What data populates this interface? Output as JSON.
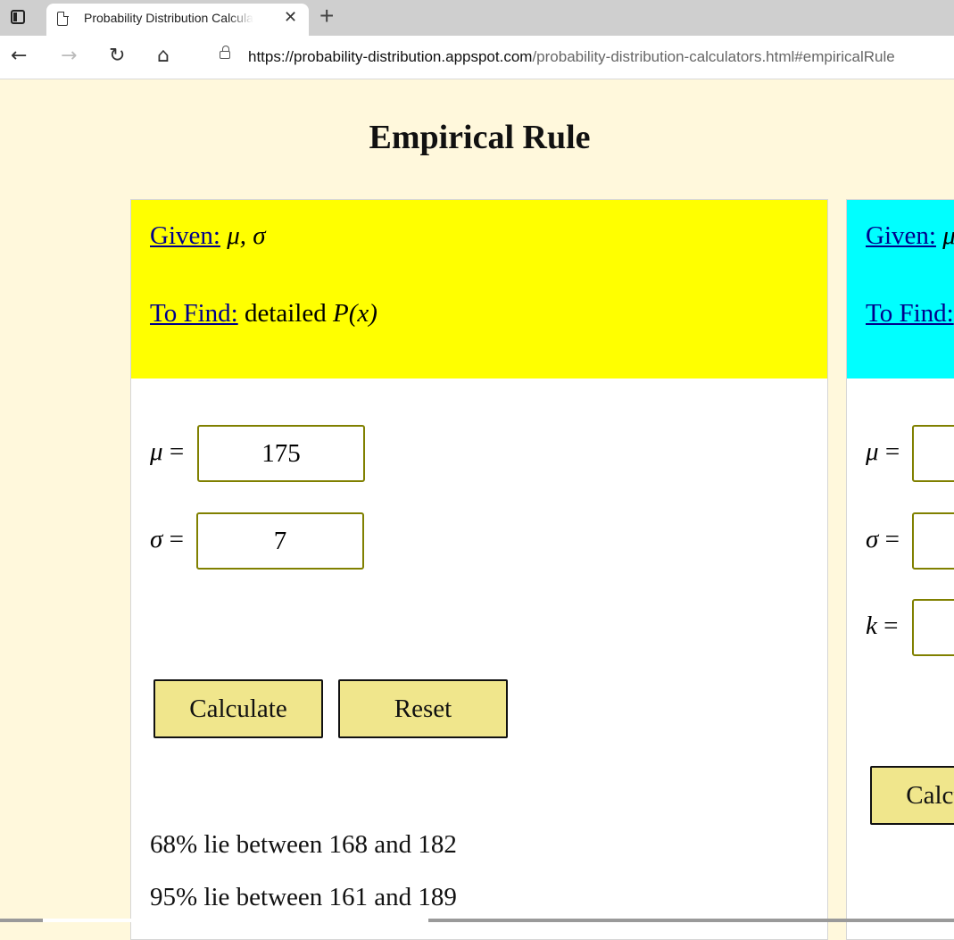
{
  "browser": {
    "tab_title": "Probability Distribution Calculators",
    "tab_close": "✕",
    "new_tab": "+",
    "url_host": "https://probability-distribution.appspot.com",
    "url_path": "/probability-distribution-calculators.html#empiricalRule",
    "back": "←",
    "forward": "→",
    "reload": "↻",
    "home": "⌂"
  },
  "page": {
    "title": "Empirical Rule"
  },
  "card1": {
    "given_label": "Given:",
    "given_vars": "μ, σ",
    "find_label": "To Find:",
    "find_text": "detailed",
    "find_math": "P(x)",
    "mu_label": "μ",
    "sigma_label": "σ",
    "equals": "=",
    "mu_value": "175",
    "sigma_value": "7",
    "calculate_label": "Calculate",
    "reset_label": "Reset",
    "results": [
      "68% lie between 168 and 182",
      "95% lie between 161 and 189"
    ],
    "head_color": "#ffff00"
  },
  "card2": {
    "given_label": "Given:",
    "given_vars": "μ",
    "find_label": "To Find:",
    "mu_label": "μ",
    "sigma_label": "σ",
    "k_label": "k",
    "equals": "=",
    "mu_value": "",
    "sigma_value": "",
    "k_value": "",
    "calculate_label": "Calculate",
    "head_color": "#00ffff"
  },
  "colors": {
    "page_bg": "#fff8dc",
    "button_bg": "#f0e68c",
    "input_border": "#808000",
    "link": "#00008b"
  }
}
